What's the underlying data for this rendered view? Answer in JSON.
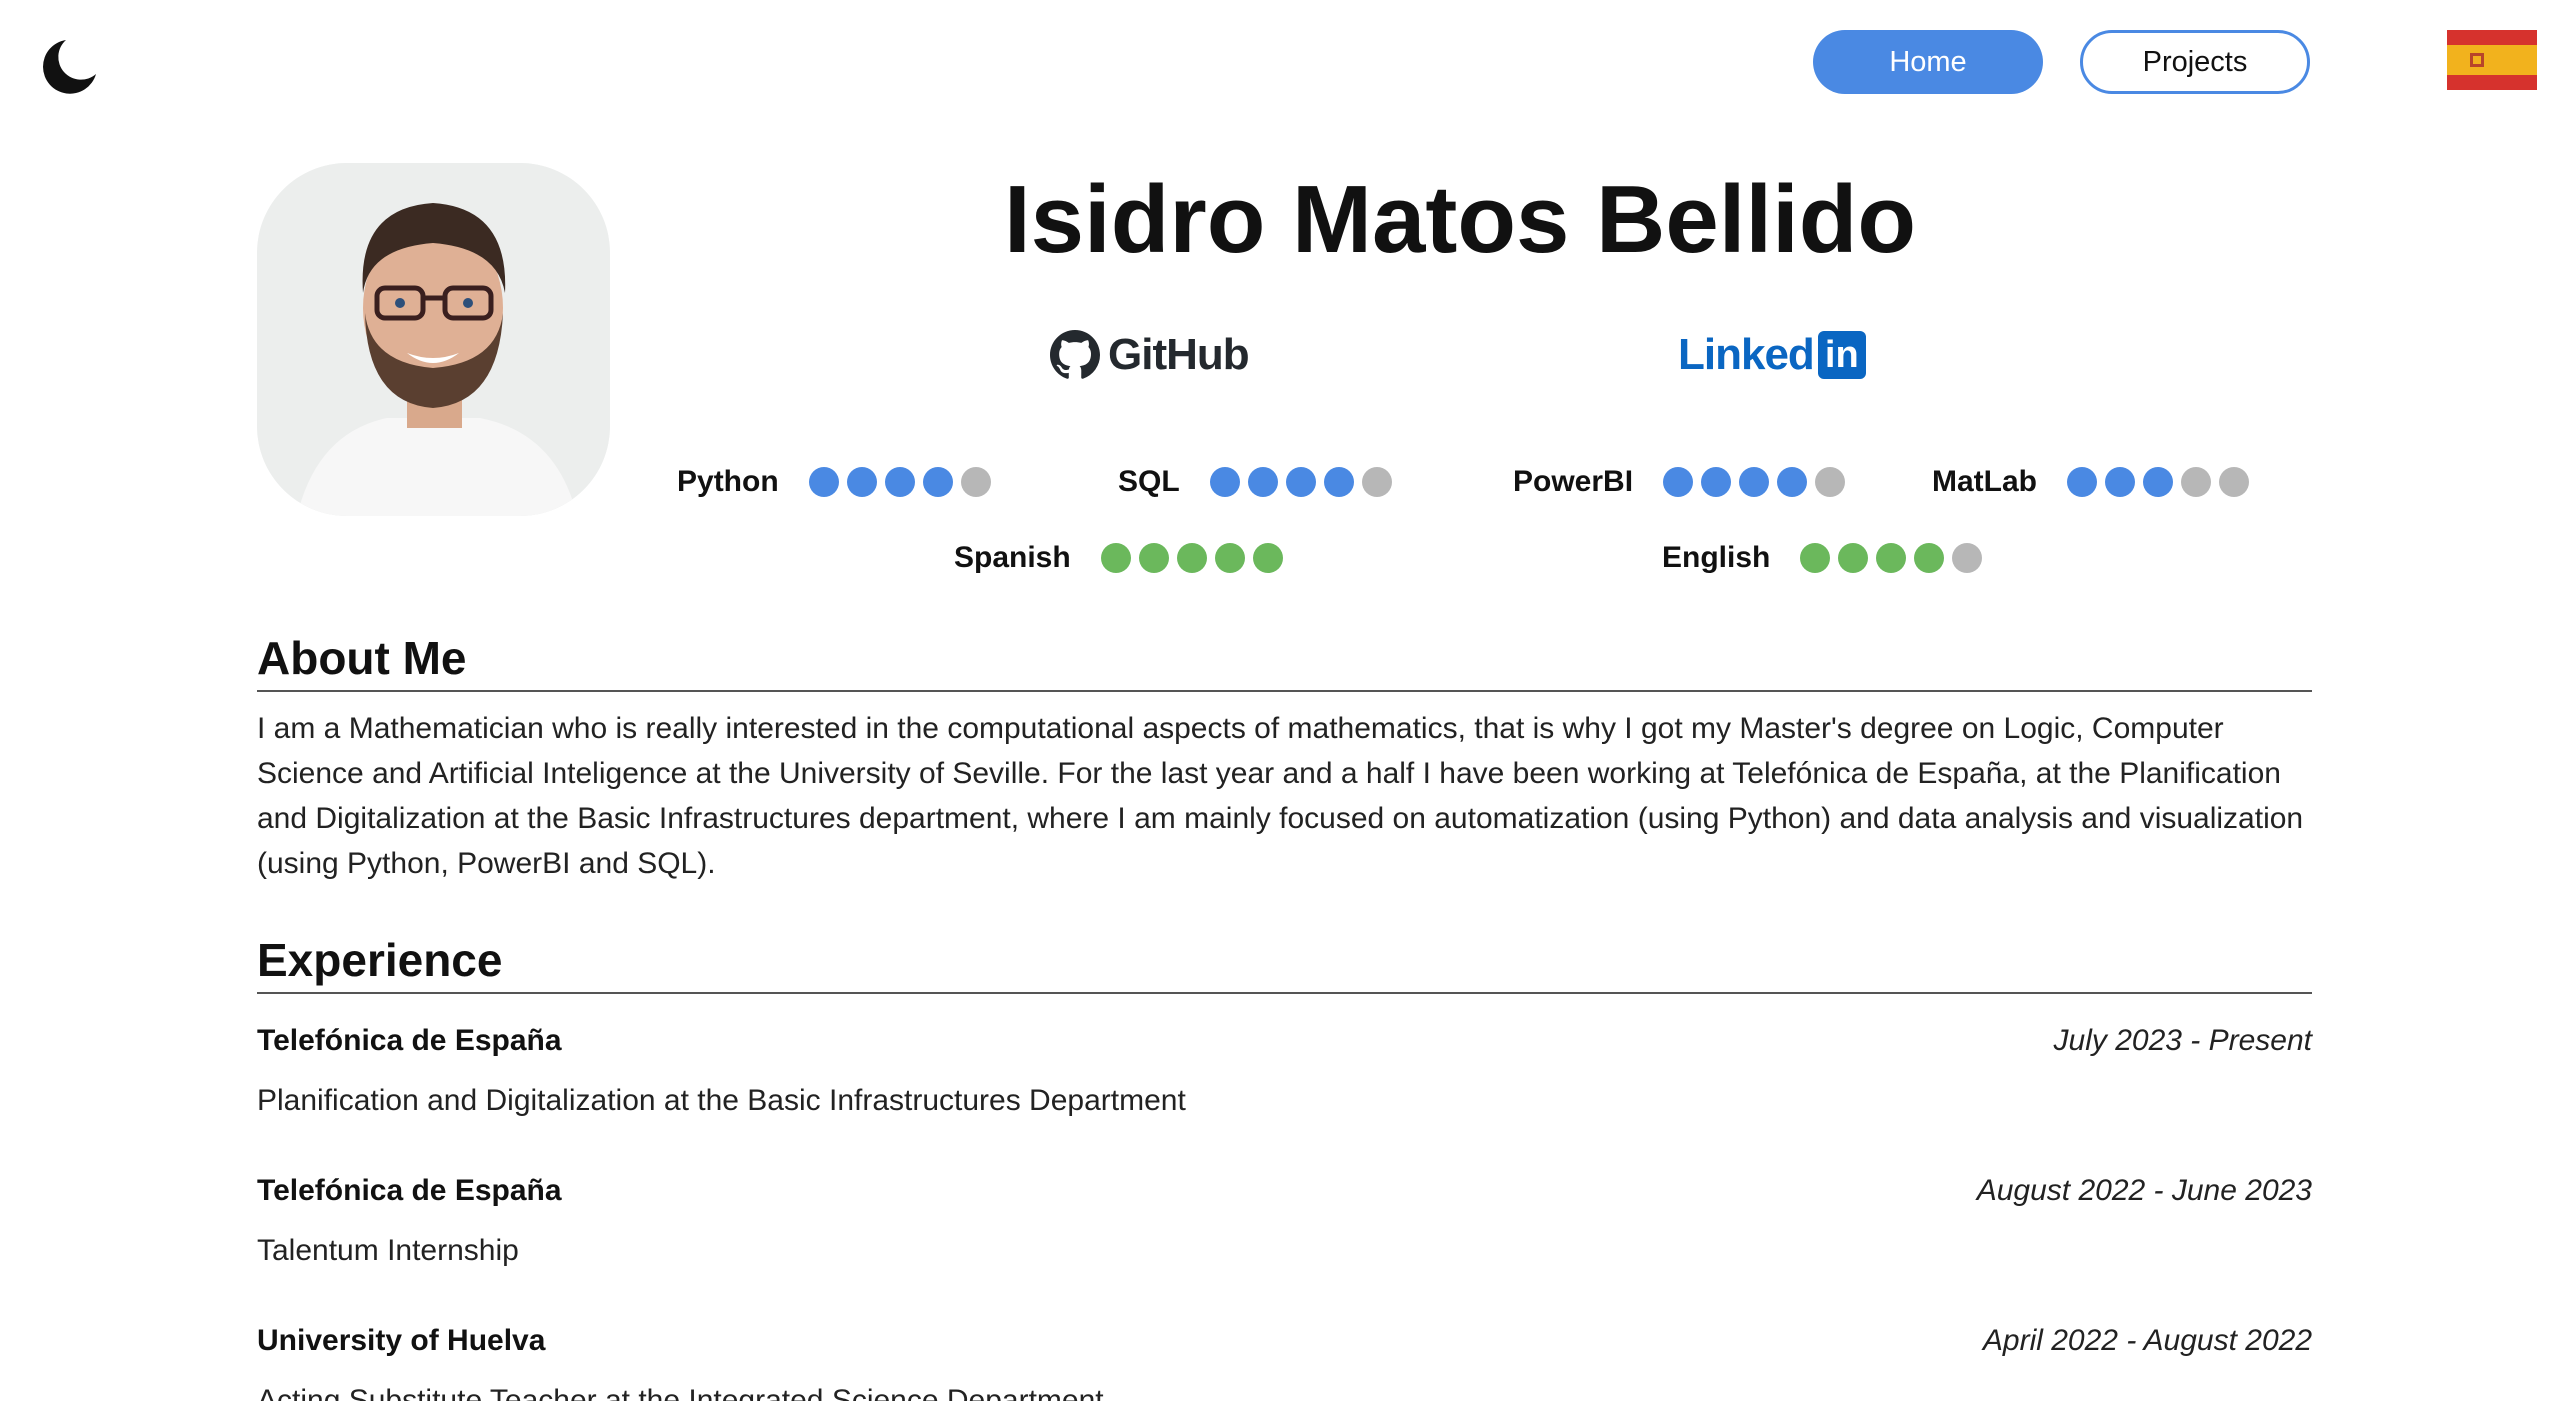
{
  "nav": {
    "home_label": "Home",
    "projects_label": "Projects",
    "theme_icon": "moon-icon",
    "language_icon": "spain-flag-icon"
  },
  "profile": {
    "name": "Isidro Matos Bellido",
    "github_label": "GitHub",
    "linkedin_label": "Linked",
    "linkedin_badge": "in"
  },
  "colors": {
    "accent_blue": "#4a89e3",
    "skill_green": "#6bb85c",
    "dot_empty": "#b7b7b7"
  },
  "skills": [
    {
      "label": "Python",
      "level": 4,
      "max": 5,
      "color": "blue"
    },
    {
      "label": "SQL",
      "level": 4,
      "max": 5,
      "color": "blue"
    },
    {
      "label": "PowerBI",
      "level": 4,
      "max": 5,
      "color": "blue"
    },
    {
      "label": "MatLab",
      "level": 3,
      "max": 5,
      "color": "blue"
    }
  ],
  "languages": [
    {
      "label": "Spanish",
      "level": 5,
      "max": 5,
      "color": "green"
    },
    {
      "label": "English",
      "level": 4,
      "max": 5,
      "color": "green"
    }
  ],
  "about": {
    "heading": "About Me",
    "text": "I am a Mathematician who is really interested in the computational aspects of mathematics, that is why I got my Master's degree on Logic, Computer Science and Artificial Inteligence at the University of Seville. For the last year and a half I have been working at Telefónica de España, at the Planification and Digitalization at the Basic Infrastructures department, where I am mainly focused on automatization (using Python) and data analysis and visualization (using Python, PowerBI and SQL)."
  },
  "experience": {
    "heading": "Experience",
    "items": [
      {
        "company": "Telefónica de España",
        "date": "July 2023 - Present",
        "role": "Planification and Digitalization at the Basic Infrastructures Department"
      },
      {
        "company": "Telefónica de España",
        "date": "August 2022 - June 2023",
        "role": "Talentum Internship"
      },
      {
        "company": "University of Huelva",
        "date": "April 2022 - August 2022",
        "role": "Acting Substitute Teacher at the Integrated Science Department"
      }
    ]
  }
}
